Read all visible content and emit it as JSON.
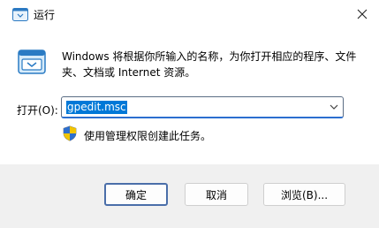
{
  "window": {
    "title": "运行"
  },
  "dialog": {
    "description": "Windows 将根据你所输入的名称，为你打开相应的程序、文件夹、文档或 Internet 资源。",
    "open_label": "打开(O):",
    "open_value": "gpedit.msc",
    "admin_note": "使用管理权限创建此任务。"
  },
  "buttons": {
    "ok": "确定",
    "cancel": "取消",
    "browse": "浏览(B)..."
  },
  "icons": {
    "title": "run-icon",
    "close": "close-icon",
    "dropdown": "chevron-down-icon",
    "admin": "uac-shield-icon"
  },
  "colors": {
    "selection": "#0078d7",
    "focus_border": "#4a6ea9"
  }
}
